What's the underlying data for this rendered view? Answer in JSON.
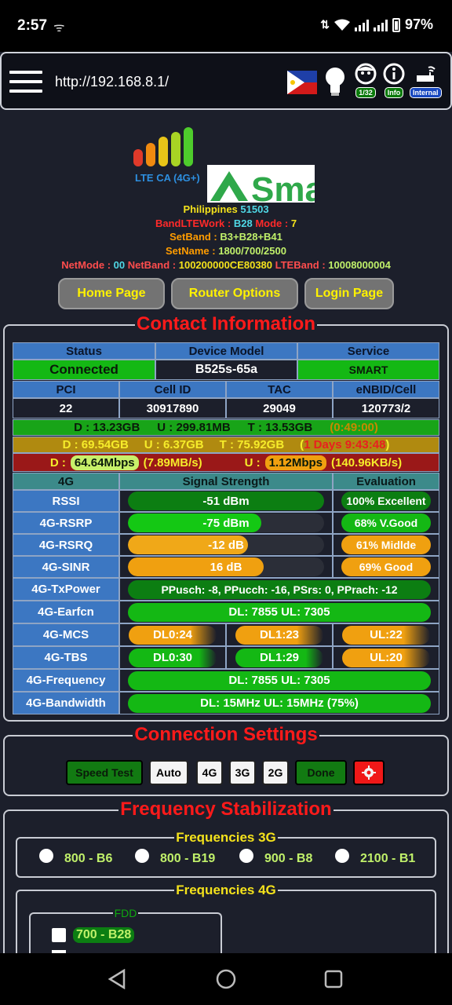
{
  "statusbar": {
    "time": "2:57",
    "battery": "97%"
  },
  "browser": {
    "url": "http://192.168.8.1/",
    "badges": [
      "1/32",
      "Info",
      "Internal"
    ]
  },
  "header": {
    "lte_label": "LTE CA (4G+)",
    "logo_text": "Sma",
    "country": "Philippines",
    "plmn": "51503",
    "band_label": "BandLTEWork : ",
    "band": "B28",
    "mode_label": "Mode : ",
    "mode": "7",
    "setband_label": "SetBand : ",
    "setband": "B3+B28+B41",
    "setname_label": "SetName : ",
    "setname": "1800/700/2500",
    "netmode_label": "NetMode : ",
    "netmode": "00",
    "netband_label": "NetBand : ",
    "netband": "100200000CE80380",
    "lteband_label": "LTEBand : ",
    "lteband": "10008000004"
  },
  "nav": {
    "home": "Home Page",
    "router": "Router Options",
    "login": "Login Page"
  },
  "contact": {
    "title": "Contact Information",
    "hdr_status": "Status",
    "hdr_model": "Device Model",
    "hdr_service": "Service",
    "status": "Connected",
    "model": "B525s-65a",
    "service": "SMART",
    "hdr_pci": "PCI",
    "hdr_cell": "Cell ID",
    "hdr_tac": "TAC",
    "hdr_enb": "eNBID/Cell",
    "pci": "22",
    "cell": "30917890",
    "tac": "29049",
    "enb": "120773/2",
    "row1_d": "D : 13.23GB",
    "row1_u": "U : 299.81MB",
    "row1_t": "T : 13.53GB",
    "row1_time": "(0:49:00)",
    "row2_d": "D : 69.54GB",
    "row2_u": "U : 6.37GB",
    "row2_t": "T : 75.92GB",
    "row2_time": "1 Days 9:43:48",
    "row3_d_label": "D :",
    "row3_d": "64.64Mbps",
    "row3_d_mb": "(7.89MB/s)",
    "row3_u_label": "U :",
    "row3_u": "1.12Mbps",
    "row3_u_mb": "(140.96KB/s)",
    "hdr_4g": "4G",
    "hdr_signal": "Signal Strength",
    "hdr_eval": "Evaluation",
    "rows": [
      {
        "label": "RSSI",
        "value": "-51 dBm",
        "fill": 1.0,
        "color": "#0c7e12",
        "eval": "100% Excellent",
        "eval_color": "#0c7e12"
      },
      {
        "label": "4G-RSRP",
        "value": "-75 dBm",
        "fill": 0.68,
        "color": "#14c814",
        "eval": "68% V.Good",
        "eval_color": "#14b814"
      },
      {
        "label": "4G-RSRQ",
        "value": "-12 dB",
        "fill": 0.61,
        "color": "#f0a818",
        "eval": "61% Midlde",
        "eval_color": "#f0a010"
      },
      {
        "label": "4G-SINR",
        "value": "16 dB",
        "fill": 0.69,
        "color": "#f0a010",
        "eval": "69% Good",
        "eval_color": "#f0a010"
      }
    ],
    "txpower_label": "4G-TxPower",
    "txpower": "PPusch: -8, PPucch: -16, PSrs: 0, PPrach: -12",
    "earfcn_label": "4G-Earfcn",
    "earfcn": "DL: 7855 UL: 7305",
    "mcs_label": "4G-MCS",
    "mcs": [
      "DL0:24",
      "DL1:23",
      "UL:22"
    ],
    "tbs_label": "4G-TBS",
    "tbs": [
      "DL0:30",
      "DL1:29",
      "UL:20"
    ],
    "freq_label": "4G-Frequency",
    "freq": "DL: 7855 UL: 7305",
    "bw_label": "4G-Bandwidth",
    "bw": "DL: 15MHz UL: 15MHz (75%)"
  },
  "connection": {
    "title": "Connection Settings",
    "speed": "Speed Test",
    "auto": "Auto",
    "g4": "4G",
    "g3": "3G",
    "g2": "2G",
    "done": "Done"
  },
  "frequency": {
    "title": "Frequency Stabilization",
    "f3g_title": "Frequencies 3G",
    "f3g": [
      "800 - B6",
      "800 - B19",
      "900 - B8",
      "2100 - B1"
    ],
    "f4g_title": "Frequencies 4G",
    "fdd_title": "FDD",
    "fdd_first": "700 - B28"
  }
}
